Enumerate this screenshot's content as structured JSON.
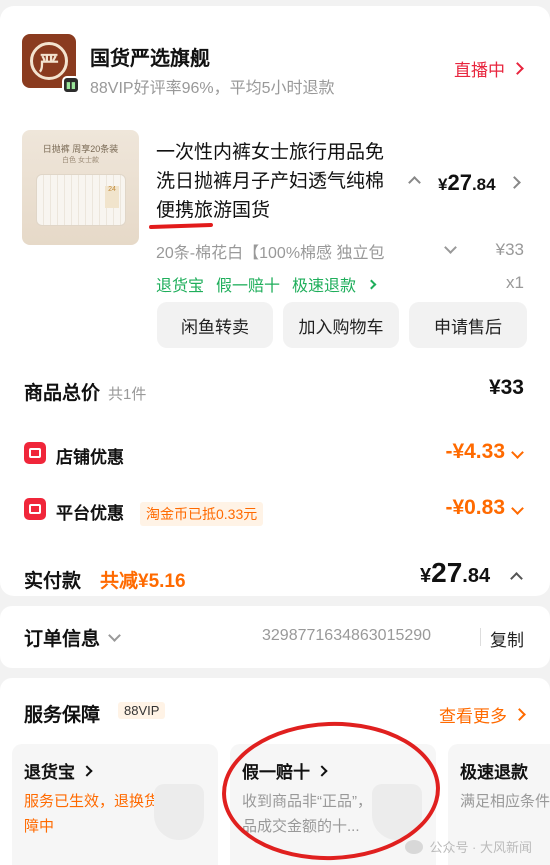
{
  "store": {
    "logo_text": "严",
    "name": "国货严选旗舰",
    "subtitle": "88VIP好评率96%，平均5小时退款",
    "live_label": "直播中"
  },
  "product": {
    "thumb_line1": "日抛裤 周享20条装",
    "thumb_line2": "白色 女士款",
    "thumb_tag": "24",
    "title": "一次性内裤女士旅行用品免洗日抛裤月子产妇透气纯棉便携旅游国货",
    "price_currency": "¥",
    "price_int": "27",
    "price_dec": ".84",
    "sku": "20条-棉花白【100%棉感 独立包",
    "sku_price": "¥33",
    "service_tags": [
      "退货宝",
      "假一赔十",
      "极速退款"
    ],
    "qty": "x1"
  },
  "actions": {
    "resell": "闲鱼转卖",
    "add_cart": "加入购物车",
    "after_sale": "申请售后"
  },
  "summary": {
    "total_label": "商品总价",
    "total_count": "共1件",
    "total_value": "¥33",
    "shop_discount_label": "店铺优惠",
    "shop_discount_value": "-¥4.33",
    "platform_discount_label": "平台优惠",
    "coin_tag": "淘金币已抵0.33元",
    "platform_discount_value": "-¥0.83",
    "paid_label": "实付款",
    "paid_saving": "共减¥5.16",
    "paid_currency": "¥",
    "paid_int": "27",
    "paid_dec": ".84"
  },
  "order": {
    "label": "订单信息",
    "number": "3298771634863015290",
    "copy": "复制"
  },
  "services": {
    "title": "服务保障",
    "badge": "88VIP",
    "more": "查看更多",
    "cards": [
      {
        "name": "退货宝",
        "desc": "服务已生效，退换货运费保障中",
        "desc_color": "#ff6a00"
      },
      {
        "name": "假一赔十",
        "desc": "收到商品非“正品”，可获商品成交金额的十...",
        "desc_color": "#999999"
      },
      {
        "name": "极速退款",
        "desc": "满足相应条件，速退款到账",
        "desc_color": "#999999"
      }
    ]
  },
  "watermark": "公众号 · 大风新闻",
  "colors": {
    "accent_red": "#e8253e",
    "accent_orange": "#ff6a00",
    "service_green": "#1fae5b",
    "annotation_red": "#e0201f"
  },
  "icons": {
    "store_badge": "live-tag-icon",
    "shop_discount": "store-coupon-icon",
    "platform_discount": "platform-coupon-icon"
  }
}
